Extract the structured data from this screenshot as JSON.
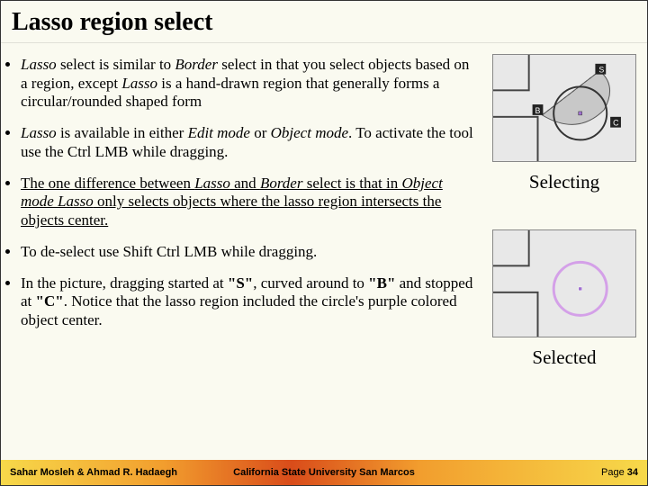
{
  "title": "Lasso region select",
  "bullets": {
    "b1_a": "Lasso",
    "b1_b": " select is similar to ",
    "b1_c": "Border",
    "b1_d": " select in that you select objects based on a region, except ",
    "b1_e": "Lasso",
    "b1_f": " is a hand-drawn region that generally forms a circular/rounded shaped form",
    "b2_a": "Lasso",
    "b2_b": " is available in either ",
    "b2_c": "Edit mode",
    "b2_d": " or ",
    "b2_e": "Object mode",
    "b2_f": ". To activate the tool use the Ctrl LMB while dragging.",
    "b3_a": "The one difference between ",
    "b3_b": "Lasso",
    "b3_c": " and ",
    "b3_d": "Border",
    "b3_e": " select is that in ",
    "b3_f": "Object mode Lasso",
    "b3_g": " only selects objects where the lasso region intersects the objects center.",
    "b4": "To de-select use Shift Ctrl LMB while dragging.",
    "b5_a": "In the picture, dragging started at ",
    "b5_b": "\"S\"",
    "b5_c": ", curved around to ",
    "b5_d": "\"B\"",
    "b5_e": " and stopped at ",
    "b5_f": "\"C\"",
    "b5_g": ". Notice that the lasso region included the circle's purple colored object center."
  },
  "captions": {
    "top": "Selecting",
    "bottom": "Selected"
  },
  "figure_labels": {
    "S": "S",
    "B": "B",
    "C": "C"
  },
  "footer": {
    "left": "Sahar Mosleh & Ahmad R. Hadaegh",
    "center": "California State University San Marcos",
    "right_prefix": "Page ",
    "page": "34"
  }
}
